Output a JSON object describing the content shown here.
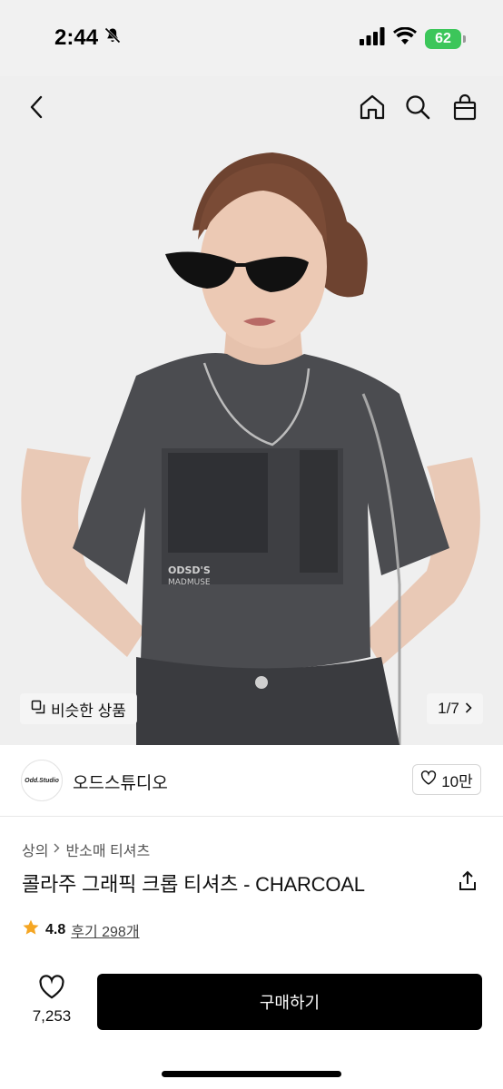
{
  "status": {
    "time": "2:44",
    "battery": "62"
  },
  "icons": {
    "back": "chevron-left-icon",
    "home": "home-icon",
    "search": "search-icon",
    "bag": "shopping-bag-icon",
    "bell_muted": "bell-slash-icon",
    "share": "share-icon",
    "heart": "heart-icon",
    "star": "star-icon",
    "similar": "similar-items-icon"
  },
  "gallery": {
    "similar_label": "비슷한 상품",
    "page_indicator": "1/7"
  },
  "store": {
    "logo_text": "Odd.Studio",
    "name": "오드스튜디오",
    "likes": "10만"
  },
  "product": {
    "breadcrumb": [
      "상의",
      "반소매 티셔츠"
    ],
    "title": "콜라주 그래픽 크롭 티셔츠 - CHARCOAL",
    "rating": "4.8",
    "reviews": "후기 298개"
  },
  "bottom_bar": {
    "wish_count": "7,253",
    "buy_label": "구매하기"
  },
  "colors": {
    "accent_star": "#f5a623",
    "buy_button": "#000000",
    "battery": "#3cc65a"
  }
}
